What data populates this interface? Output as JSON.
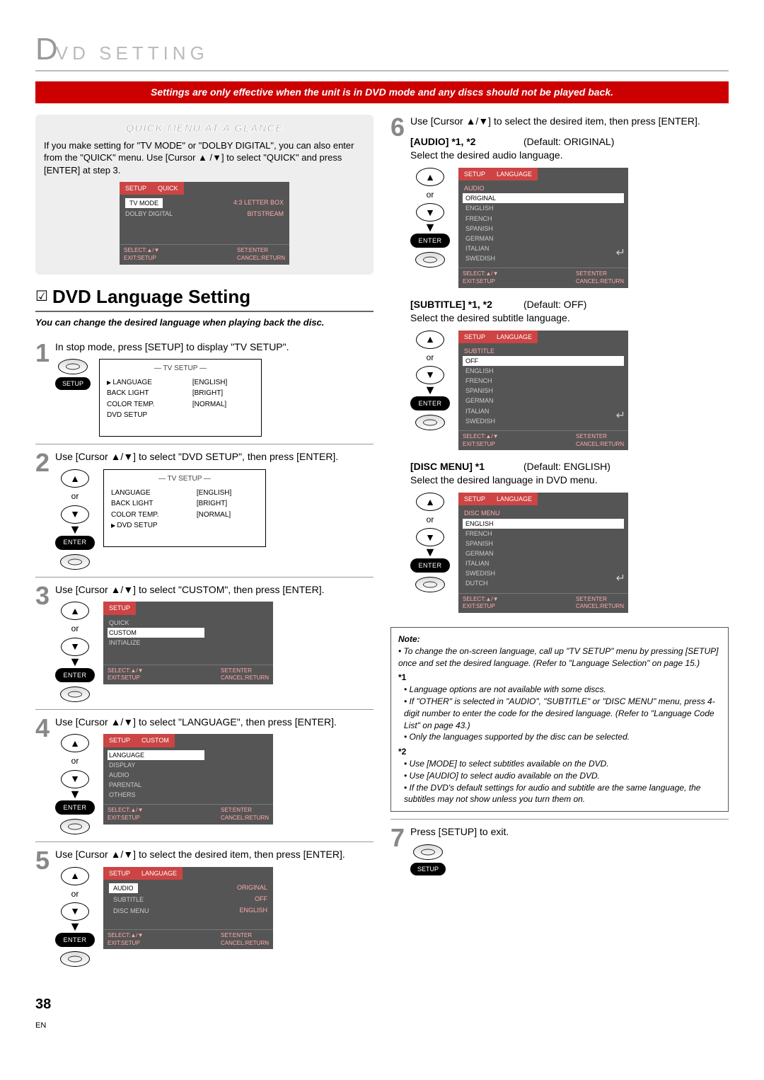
{
  "header": {
    "big": "D",
    "rest": "VD  SETTING"
  },
  "redbar": "Settings are only effective when the unit is in DVD mode and any discs should not be played back.",
  "quick": {
    "title": "QUICK MENU AT A GLANCE",
    "text": "If you make setting for \"TV MODE\" or \"DOLBY DIGITAL\", you can also enter from the \"QUICK\" menu. Use [Cursor ▲ /▼] to select \"QUICK\" and press [ENTER] at step 3.",
    "osd": {
      "tab1": "SETUP",
      "tab2": "QUICK",
      "row1": [
        "TV MODE",
        "4:3 LETTER BOX"
      ],
      "row2": [
        "DOLBY DIGITAL",
        "BITSTREAM"
      ],
      "foot": {
        "l": "SELECT:▲/▼\nEXIT:SETUP",
        "r": "SET:ENTER\nCANCEL:RETURN"
      }
    }
  },
  "section": {
    "chk": "☑",
    "title": "DVD Language Setting",
    "sub": "You can change the desired language when playing back the disc."
  },
  "or": "or",
  "enter": "ENTER",
  "setup": "SETUP",
  "steps": {
    "1": {
      "t": "In stop mode, press [SETUP] to display \"TV SETUP\".",
      "osd": {
        "title": "—  TV SETUP  —",
        "rows": [
          [
            "LANGUAGE",
            "[ENGLISH]",
            "▶"
          ],
          [
            "BACK LIGHT",
            "[BRIGHT]",
            ""
          ],
          [
            "COLOR TEMP.",
            "[NORMAL]",
            ""
          ],
          [
            "DVD SETUP",
            "",
            ""
          ]
        ]
      }
    },
    "2": {
      "t": "Use [Cursor ▲/▼] to select \"DVD SETUP\", then press [ENTER].",
      "osd": {
        "title": "—  TV SETUP  —",
        "rows": [
          [
            "LANGUAGE",
            "[ENGLISH]",
            ""
          ],
          [
            "BACK LIGHT",
            "[BRIGHT]",
            ""
          ],
          [
            "COLOR TEMP.",
            "[NORMAL]",
            ""
          ],
          [
            "DVD SETUP",
            "",
            "▶"
          ]
        ]
      }
    },
    "3": {
      "t": "Use [Cursor ▲/▼] to select \"CUSTOM\", then press [ENTER].",
      "osd": {
        "tab": "SETUP",
        "items": [
          "QUICK",
          "CUSTOM",
          "INITIALIZE"
        ],
        "sel": "CUSTOM"
      }
    },
    "4": {
      "t": "Use [Cursor ▲/▼] to select \"LANGUAGE\", then press [ENTER].",
      "osd": {
        "tab1": "SETUP",
        "tab2": "CUSTOM",
        "items": [
          "LANGUAGE",
          "DISPLAY",
          "AUDIO",
          "PARENTAL",
          "OTHERS"
        ],
        "sel": "LANGUAGE"
      }
    },
    "5": {
      "t": "Use [Cursor ▲/▼] to select the desired item, then press [ENTER].",
      "osd": {
        "tab1": "SETUP",
        "tab2": "LANGUAGE",
        "rows": [
          [
            "AUDIO",
            "ORIGINAL"
          ],
          [
            "SUBTITLE",
            "OFF"
          ],
          [
            "DISC MENU",
            "ENGLISH"
          ]
        ],
        "sel": "AUDIO"
      }
    },
    "6": {
      "t": "Use [Cursor ▲/▼] to select the desired item, then press [ENTER].",
      "audio": {
        "label": "[AUDIO] *1, *2",
        "def": "(Default: ORIGINAL)",
        "desc": "Select the desired audio language.",
        "osd": {
          "tab1": "SETUP",
          "tab2": "LANGUAGE",
          "cat": "AUDIO",
          "items": [
            "ORIGINAL",
            "ENGLISH",
            "FRENCH",
            "SPANISH",
            "GERMAN",
            "ITALIAN",
            "SWEDISH"
          ],
          "sel": "ORIGINAL"
        }
      },
      "subtitle": {
        "label": "[SUBTITLE] *1, *2",
        "def": "(Default: OFF)",
        "desc": "Select the desired subtitle language.",
        "osd": {
          "tab1": "SETUP",
          "tab2": "LANGUAGE",
          "cat": "SUBTITLE",
          "items": [
            "OFF",
            "ENGLISH",
            "FRENCH",
            "SPANISH",
            "GERMAN",
            "ITALIAN",
            "SWEDISH"
          ],
          "sel": "OFF"
        }
      },
      "disc": {
        "label": "[DISC MENU] *1",
        "def": "(Default: ENGLISH)",
        "desc": "Select the desired language in DVD menu.",
        "osd": {
          "tab1": "SETUP",
          "tab2": "LANGUAGE",
          "cat": "DISC MENU",
          "items": [
            "ENGLISH",
            "FRENCH",
            "SPANISH",
            "GERMAN",
            "ITALIAN",
            "SWEDISH",
            "DUTCH"
          ],
          "sel": "ENGLISH"
        }
      }
    },
    "7": {
      "t": "Press [SETUP] to exit."
    }
  },
  "note": {
    "title": "Note:",
    "main": "• To change the on-screen language, call up \"TV SETUP\" menu by pressing [SETUP] once and set the desired language. (Refer to \"Language Selection\" on page 15.)",
    "s1h": "*1",
    "s1": [
      "• Language options are not available with some discs.",
      "• If \"OTHER\" is selected in \"AUDIO\", \"SUBTITLE\" or \"DISC MENU\" menu, press 4-digit number to enter the code for the desired language. (Refer to \"Language Code List\" on page 43.)",
      "• Only the languages supported by the disc can be selected."
    ],
    "s2h": "*2",
    "s2": [
      "• Use [MODE] to select subtitles available on the DVD.",
      "• Use [AUDIO] to select audio available on the DVD.",
      "• If the DVD's default settings for audio and subtitle are the same language, the subtitles may not show unless you turn them on."
    ]
  },
  "osdfoot": {
    "l": "SELECT:▲/▼\nEXIT:SETUP",
    "r": "SET:ENTER\nCANCEL:RETURN"
  },
  "page": "38",
  "en": "EN"
}
